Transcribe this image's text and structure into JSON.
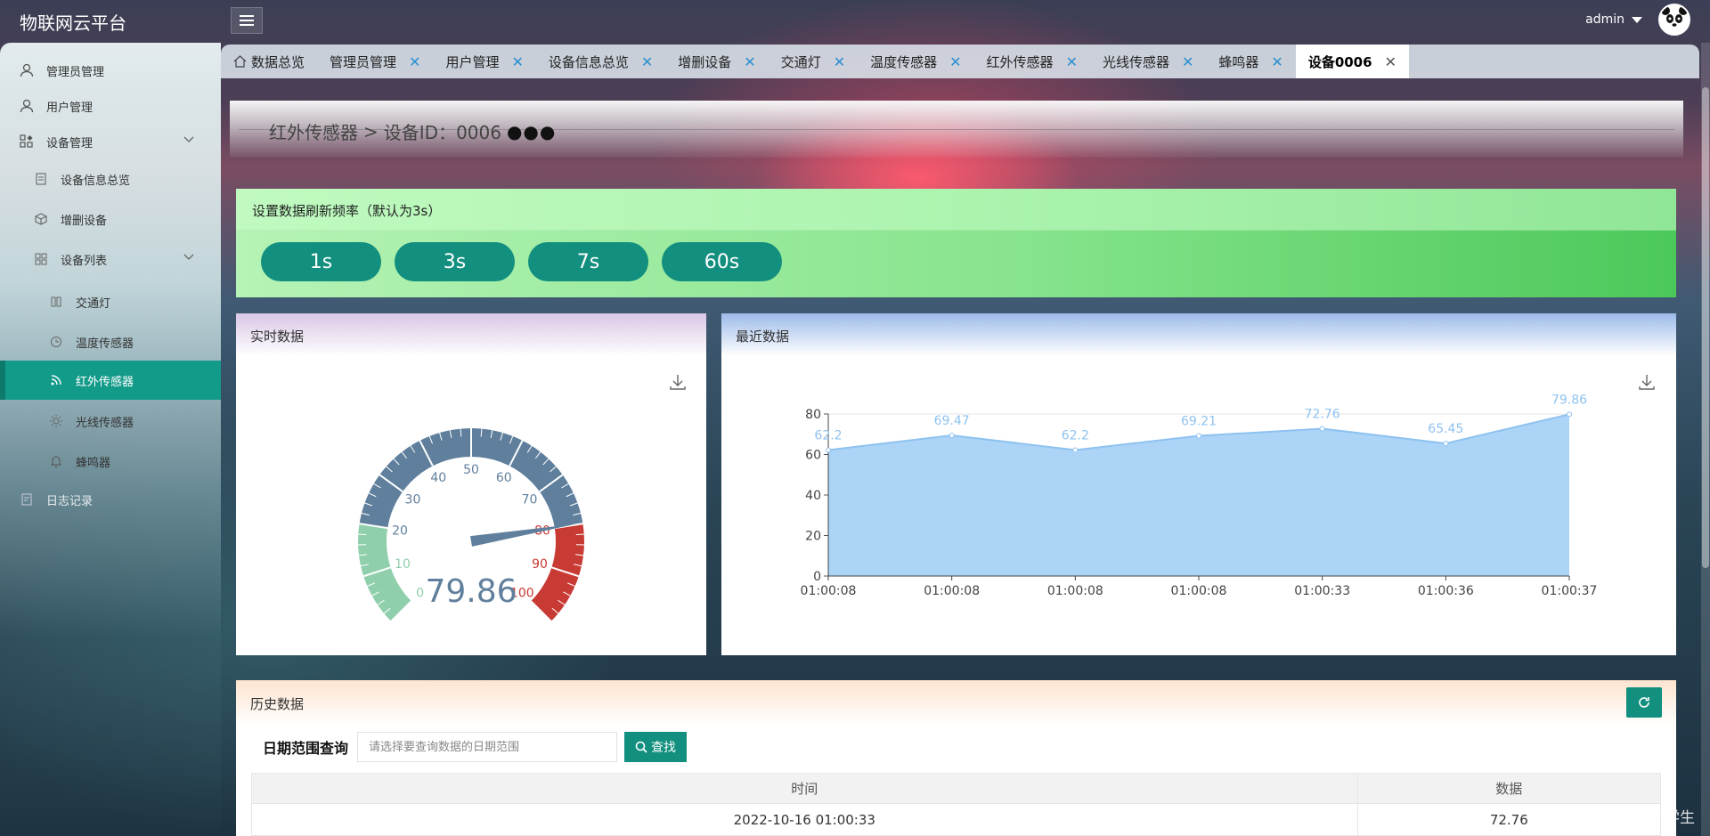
{
  "app": {
    "title": "物联网云平台"
  },
  "header": {
    "username": "admin"
  },
  "sidebar": {
    "items": [
      {
        "label": "管理员管理",
        "icon": "user-icon"
      },
      {
        "label": "用户管理",
        "icon": "user-icon"
      },
      {
        "label": "设备管理",
        "icon": "grid-icon"
      },
      {
        "label": "设备信息总览",
        "icon": "document-icon"
      },
      {
        "label": "增删设备",
        "icon": "cube-icon"
      },
      {
        "label": "设备列表",
        "icon": "list-icon"
      },
      {
        "label": "交通灯",
        "icon": "traffic-light-icon"
      },
      {
        "label": "温度传感器",
        "icon": "thermometer-icon"
      },
      {
        "label": "红外传感器",
        "icon": "rss-icon"
      },
      {
        "label": "光线传感器",
        "icon": "sun-icon"
      },
      {
        "label": "蜂鸣器",
        "icon": "bell-icon"
      },
      {
        "label": "日志记录",
        "icon": "log-icon"
      }
    ]
  },
  "tabs": [
    {
      "label": "数据总览",
      "closable": false
    },
    {
      "label": "管理员管理",
      "closable": true
    },
    {
      "label": "用户管理",
      "closable": true
    },
    {
      "label": "设备信息总览",
      "closable": true
    },
    {
      "label": "增删设备",
      "closable": true
    },
    {
      "label": "交通灯",
      "closable": true
    },
    {
      "label": "温度传感器",
      "closable": true
    },
    {
      "label": "红外传感器",
      "closable": true
    },
    {
      "label": "光线传感器",
      "closable": true
    },
    {
      "label": "蜂鸣器",
      "closable": true
    },
    {
      "label": "设备0006",
      "closable": true,
      "active": true
    }
  ],
  "breadcrumb": {
    "section": "红外传感器",
    "separator": ">",
    "device": "设备ID：0006",
    "status_dots": "●●●"
  },
  "frequency": {
    "title": "设置数据刷新频率（默认为3s）",
    "options": [
      "1s",
      "3s",
      "7s",
      "60s"
    ]
  },
  "realtime": {
    "title": "实时数据"
  },
  "recent": {
    "title": "最近数据"
  },
  "colors": {
    "accent": "#128f7e",
    "chart_fill": "#abd4f6",
    "chart_line": "#8ec2f0",
    "gauge_low": "#8fcfab",
    "gauge_mid": "#5f7f9c",
    "gauge_high": "#c83a34"
  },
  "chart_data": [
    {
      "type": "gauge",
      "value": 79.86,
      "value_label": "79.86",
      "min": 0,
      "max": 100,
      "ticks": [
        "0",
        "10",
        "20",
        "30",
        "40",
        "50",
        "60",
        "70",
        "80",
        "90",
        "100"
      ],
      "bands": [
        {
          "from": 0,
          "to": 20,
          "color": "#8fcfab"
        },
        {
          "from": 20,
          "to": 80,
          "color": "#5f7f9c"
        },
        {
          "from": 80,
          "to": 100,
          "color": "#c83a34"
        }
      ]
    },
    {
      "type": "area",
      "x": [
        "01:00:08",
        "01:00:08",
        "01:00:08",
        "01:00:08",
        "01:00:33",
        "01:00:36",
        "01:00:37"
      ],
      "values": [
        62.2,
        69.47,
        62.2,
        69.21,
        72.76,
        65.45,
        79.86
      ],
      "value_labels": [
        "62.2",
        "69.47",
        "62.2",
        "69.21",
        "72.76",
        "65.45",
        "79.86"
      ],
      "yticks": [
        "0",
        "20",
        "40",
        "60",
        "80"
      ],
      "ylim": [
        0,
        80
      ],
      "grid": true
    }
  ],
  "history": {
    "title": "历史数据",
    "query_label": "日期范围查询",
    "query_placeholder": "请选择要查询数据的日期范围",
    "search_label": "查找",
    "columns": [
      "时间",
      "数据"
    ],
    "rows": [
      [
        "2022-10-16 01:00:33",
        "72.76"
      ]
    ]
  },
  "watermark": "CSDN @-IT界的小学生"
}
